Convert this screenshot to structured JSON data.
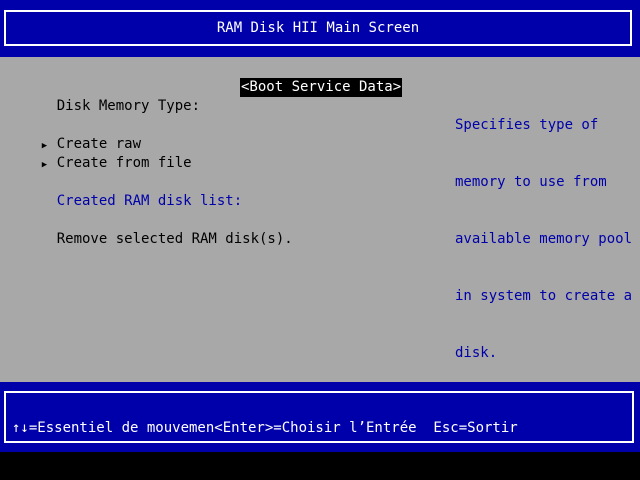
{
  "header": {
    "title": "RAM Disk HII Main Screen"
  },
  "form": {
    "disk_memory_type_label": "Disk Memory Type:",
    "disk_memory_type_value": "<Boot Service Data>",
    "create_raw_label": "Create raw",
    "create_from_file_label": "Create from file",
    "created_list_label": "Created RAM disk list:",
    "remove_label": "Remove selected RAM disk(s).",
    "pointer_glyph": "▶"
  },
  "help": {
    "lines": [
      "Specifies type of",
      "memory to use from",
      "available memory pool",
      "in system to create a",
      "disk."
    ]
  },
  "footer": {
    "hint": "↑↓=Essentiel de mouvemen<Enter>=Choisir l’Entrée  Esc=Sortir"
  },
  "colors": {
    "background": "#a8a8a8",
    "band": "#0000aa",
    "text": "#000000",
    "highlight_bg": "#000000",
    "highlight_fg": "#ffffff",
    "help_text": "#0000aa"
  }
}
